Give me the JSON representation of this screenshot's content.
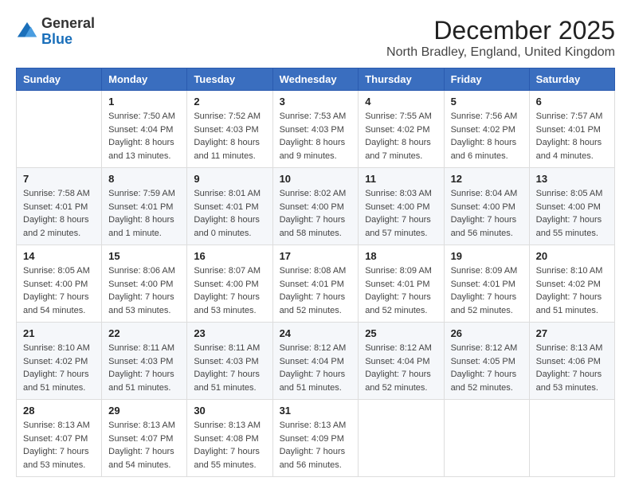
{
  "logo": {
    "general": "General",
    "blue": "Blue"
  },
  "title": "December 2025",
  "location": "North Bradley, England, United Kingdom",
  "days_of_week": [
    "Sunday",
    "Monday",
    "Tuesday",
    "Wednesday",
    "Thursday",
    "Friday",
    "Saturday"
  ],
  "weeks": [
    [
      {
        "day": "",
        "info": ""
      },
      {
        "day": "1",
        "info": "Sunrise: 7:50 AM\nSunset: 4:04 PM\nDaylight: 8 hours\nand 13 minutes."
      },
      {
        "day": "2",
        "info": "Sunrise: 7:52 AM\nSunset: 4:03 PM\nDaylight: 8 hours\nand 11 minutes."
      },
      {
        "day": "3",
        "info": "Sunrise: 7:53 AM\nSunset: 4:03 PM\nDaylight: 8 hours\nand 9 minutes."
      },
      {
        "day": "4",
        "info": "Sunrise: 7:55 AM\nSunset: 4:02 PM\nDaylight: 8 hours\nand 7 minutes."
      },
      {
        "day": "5",
        "info": "Sunrise: 7:56 AM\nSunset: 4:02 PM\nDaylight: 8 hours\nand 6 minutes."
      },
      {
        "day": "6",
        "info": "Sunrise: 7:57 AM\nSunset: 4:01 PM\nDaylight: 8 hours\nand 4 minutes."
      }
    ],
    [
      {
        "day": "7",
        "info": "Sunrise: 7:58 AM\nSunset: 4:01 PM\nDaylight: 8 hours\nand 2 minutes."
      },
      {
        "day": "8",
        "info": "Sunrise: 7:59 AM\nSunset: 4:01 PM\nDaylight: 8 hours\nand 1 minute."
      },
      {
        "day": "9",
        "info": "Sunrise: 8:01 AM\nSunset: 4:01 PM\nDaylight: 8 hours\nand 0 minutes."
      },
      {
        "day": "10",
        "info": "Sunrise: 8:02 AM\nSunset: 4:00 PM\nDaylight: 7 hours\nand 58 minutes."
      },
      {
        "day": "11",
        "info": "Sunrise: 8:03 AM\nSunset: 4:00 PM\nDaylight: 7 hours\nand 57 minutes."
      },
      {
        "day": "12",
        "info": "Sunrise: 8:04 AM\nSunset: 4:00 PM\nDaylight: 7 hours\nand 56 minutes."
      },
      {
        "day": "13",
        "info": "Sunrise: 8:05 AM\nSunset: 4:00 PM\nDaylight: 7 hours\nand 55 minutes."
      }
    ],
    [
      {
        "day": "14",
        "info": "Sunrise: 8:05 AM\nSunset: 4:00 PM\nDaylight: 7 hours\nand 54 minutes."
      },
      {
        "day": "15",
        "info": "Sunrise: 8:06 AM\nSunset: 4:00 PM\nDaylight: 7 hours\nand 53 minutes."
      },
      {
        "day": "16",
        "info": "Sunrise: 8:07 AM\nSunset: 4:00 PM\nDaylight: 7 hours\nand 53 minutes."
      },
      {
        "day": "17",
        "info": "Sunrise: 8:08 AM\nSunset: 4:01 PM\nDaylight: 7 hours\nand 52 minutes."
      },
      {
        "day": "18",
        "info": "Sunrise: 8:09 AM\nSunset: 4:01 PM\nDaylight: 7 hours\nand 52 minutes."
      },
      {
        "day": "19",
        "info": "Sunrise: 8:09 AM\nSunset: 4:01 PM\nDaylight: 7 hours\nand 52 minutes."
      },
      {
        "day": "20",
        "info": "Sunrise: 8:10 AM\nSunset: 4:02 PM\nDaylight: 7 hours\nand 51 minutes."
      }
    ],
    [
      {
        "day": "21",
        "info": "Sunrise: 8:10 AM\nSunset: 4:02 PM\nDaylight: 7 hours\nand 51 minutes."
      },
      {
        "day": "22",
        "info": "Sunrise: 8:11 AM\nSunset: 4:03 PM\nDaylight: 7 hours\nand 51 minutes."
      },
      {
        "day": "23",
        "info": "Sunrise: 8:11 AM\nSunset: 4:03 PM\nDaylight: 7 hours\nand 51 minutes."
      },
      {
        "day": "24",
        "info": "Sunrise: 8:12 AM\nSunset: 4:04 PM\nDaylight: 7 hours\nand 51 minutes."
      },
      {
        "day": "25",
        "info": "Sunrise: 8:12 AM\nSunset: 4:04 PM\nDaylight: 7 hours\nand 52 minutes."
      },
      {
        "day": "26",
        "info": "Sunrise: 8:12 AM\nSunset: 4:05 PM\nDaylight: 7 hours\nand 52 minutes."
      },
      {
        "day": "27",
        "info": "Sunrise: 8:13 AM\nSunset: 4:06 PM\nDaylight: 7 hours\nand 53 minutes."
      }
    ],
    [
      {
        "day": "28",
        "info": "Sunrise: 8:13 AM\nSunset: 4:07 PM\nDaylight: 7 hours\nand 53 minutes."
      },
      {
        "day": "29",
        "info": "Sunrise: 8:13 AM\nSunset: 4:07 PM\nDaylight: 7 hours\nand 54 minutes."
      },
      {
        "day": "30",
        "info": "Sunrise: 8:13 AM\nSunset: 4:08 PM\nDaylight: 7 hours\nand 55 minutes."
      },
      {
        "day": "31",
        "info": "Sunrise: 8:13 AM\nSunset: 4:09 PM\nDaylight: 7 hours\nand 56 minutes."
      },
      {
        "day": "",
        "info": ""
      },
      {
        "day": "",
        "info": ""
      },
      {
        "day": "",
        "info": ""
      }
    ]
  ]
}
